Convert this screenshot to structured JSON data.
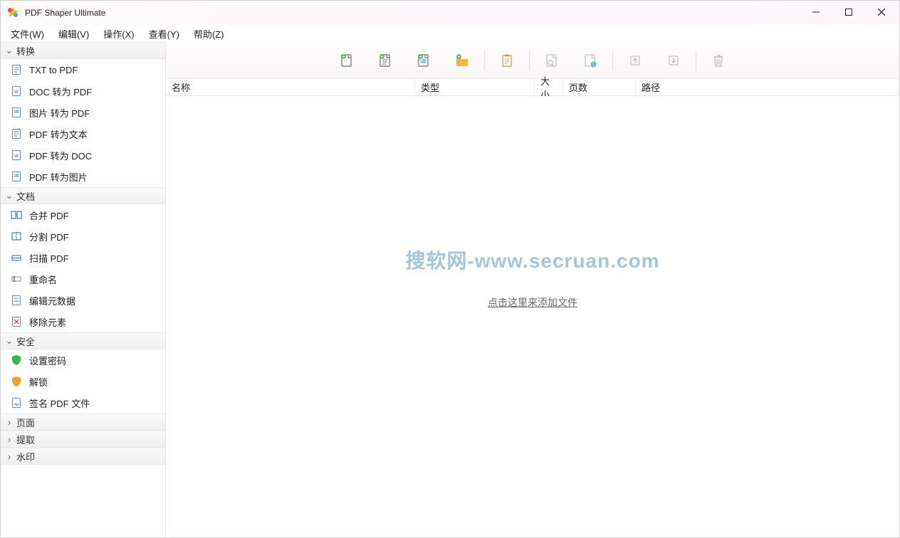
{
  "title": "PDF Shaper Ultimate",
  "menu": {
    "file": "文件(W)",
    "edit": "编辑(V)",
    "action": "操作(X)",
    "view": "查看(Y)",
    "help": "帮助(Z)"
  },
  "sidebar": {
    "groups": [
      {
        "label": "转换",
        "expanded": true,
        "items": [
          {
            "label": "TXT to PDF",
            "icon": "page-txt"
          },
          {
            "label": "DOC 转为 PDF",
            "icon": "page-doc"
          },
          {
            "label": "图片 转为 PDF",
            "icon": "page-img"
          },
          {
            "label": "PDF 转为文本",
            "icon": "page-txt"
          },
          {
            "label": "PDF 转为 DOC",
            "icon": "page-doc"
          },
          {
            "label": "PDF 转为图片",
            "icon": "page-img"
          }
        ]
      },
      {
        "label": "文档",
        "expanded": true,
        "items": [
          {
            "label": "合并 PDF",
            "icon": "merge"
          },
          {
            "label": "分割 PDF",
            "icon": "split"
          },
          {
            "label": "扫描 PDF",
            "icon": "scan"
          },
          {
            "label": "重命名",
            "icon": "rename"
          },
          {
            "label": "编辑元数据",
            "icon": "meta"
          },
          {
            "label": "移除元素",
            "icon": "remove"
          }
        ]
      },
      {
        "label": "安全",
        "expanded": true,
        "items": [
          {
            "label": "设置密码",
            "icon": "shield-green"
          },
          {
            "label": "解锁",
            "icon": "shield-orange"
          },
          {
            "label": "签名 PDF 文件",
            "icon": "sign"
          }
        ]
      },
      {
        "label": "页面",
        "expanded": false,
        "items": []
      },
      {
        "label": "提取",
        "expanded": false,
        "items": []
      },
      {
        "label": "水印",
        "expanded": false,
        "items": []
      }
    ]
  },
  "toolbar": {
    "buttons": [
      "add-file",
      "add-text",
      "add-image",
      "add-folder",
      "",
      "clipboard",
      "",
      "search",
      "info",
      "",
      "move-up",
      "move-down",
      "",
      "delete"
    ]
  },
  "columns": {
    "name": "名称",
    "type": "类型",
    "size": "大小",
    "pages": "页数",
    "path": "路径"
  },
  "watermark": "搜软网-www.secruan.com",
  "addHint": "点击这里来添加文件"
}
